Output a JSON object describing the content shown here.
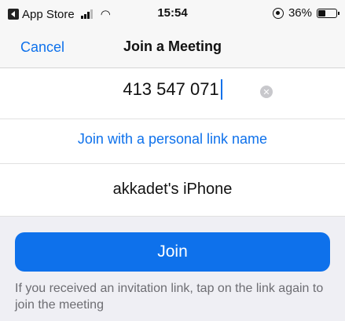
{
  "status_bar": {
    "back_app": "App Store",
    "time": "15:54",
    "battery": "36%",
    "battery_level": 0.36
  },
  "nav": {
    "cancel": "Cancel",
    "title": "Join a Meeting"
  },
  "meeting_id": {
    "value": "413 547 071"
  },
  "personal_link": {
    "label": "Join with a personal link name"
  },
  "name": {
    "value": "akkadet's iPhone"
  },
  "join": {
    "label": "Join"
  },
  "hint": {
    "text": "If you received an invitation link, tap on the link again to join the meeting"
  },
  "colors": {
    "accent": "#0e71eb",
    "background": "#efeff4"
  },
  "icons": [
    "back-to-app-icon",
    "signal-icon",
    "wifi-icon",
    "orientation-lock-icon",
    "battery-icon",
    "clear-icon"
  ]
}
